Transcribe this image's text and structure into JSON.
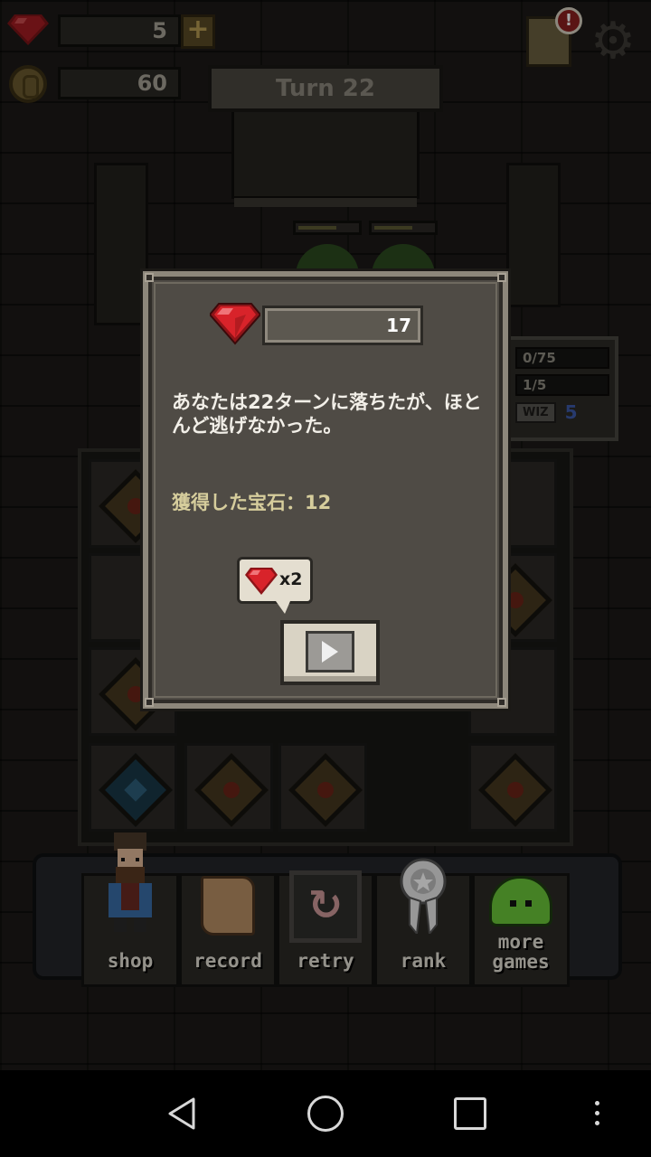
{
  "hud": {
    "gems": "5",
    "coins": "60",
    "plus": "+",
    "turn": "Turn 22",
    "alert": "!"
  },
  "side_panel": {
    "stat1": "0/75",
    "stat2": "1/5",
    "class_tag": "WIZ",
    "class_level": "5"
  },
  "dialog": {
    "gem_total": "17",
    "message": "あなたは22ターンに落ちたが、ほとんど逃げなかった。",
    "earned": "獲得した宝石：12",
    "bonus_multiplier": "x2"
  },
  "menu": [
    {
      "label": "shop"
    },
    {
      "label": "record"
    },
    {
      "label": "retry"
    },
    {
      "label": "rank"
    },
    {
      "label_line1": "more",
      "label_line2": "games"
    }
  ],
  "colors": {
    "gem_red": "#d8232a",
    "panel_bg": "#4f4b45",
    "message_text": "#f2efe8",
    "earned_text": "#d6cd9c"
  }
}
